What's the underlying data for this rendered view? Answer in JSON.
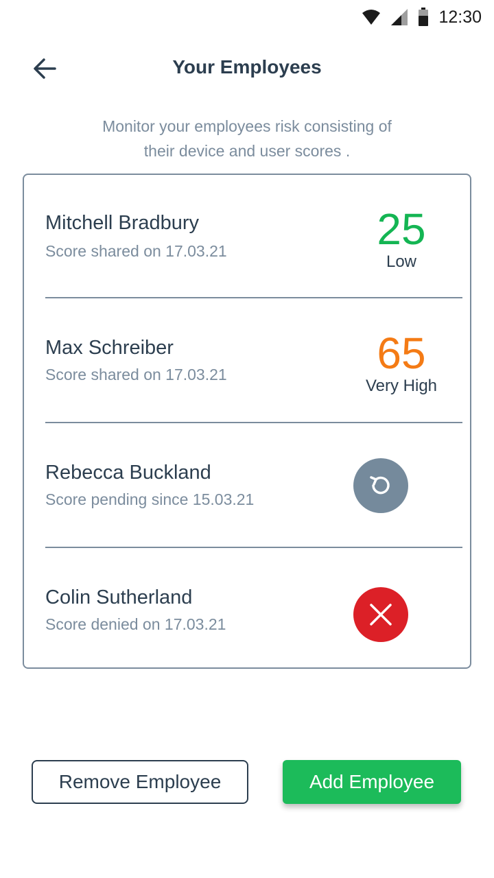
{
  "status_bar": {
    "time": "12:30",
    "icons": [
      "wifi-icon",
      "cellular-signal-icon",
      "battery-icon"
    ]
  },
  "header": {
    "back_icon": "arrow-left-icon",
    "title": "Your Employees"
  },
  "subtitle": {
    "line1": "Monitor your employees risk consisting of",
    "line2": "their device and user scores ."
  },
  "employees": [
    {
      "name": "Mitchell Bradbury",
      "meta": "Score shared on 17.03.21",
      "score": "25",
      "level": "Low",
      "status": "shared",
      "color": "#14b553"
    },
    {
      "name": "Max Schreiber",
      "meta": "Score shared on 17.03.21",
      "score": "65",
      "level": "Very High",
      "status": "shared",
      "color": "#f47b15"
    },
    {
      "name": "Rebecca Buckland",
      "meta": "Score pending since 15.03.21",
      "status": "pending",
      "icon": "refresh-icon",
      "color": "#758a9c"
    },
    {
      "name": "Colin Sutherland",
      "meta": "Score denied on 17.03.21",
      "status": "denied",
      "icon": "close-icon",
      "color": "#dc2027"
    }
  ],
  "actions": {
    "remove_label": "Remove Employee",
    "add_label": "Add Employee"
  },
  "colors": {
    "primary_text": "#2c3e4f",
    "secondary_text": "#7b8c9d",
    "accent_green": "#1cbb5a"
  }
}
